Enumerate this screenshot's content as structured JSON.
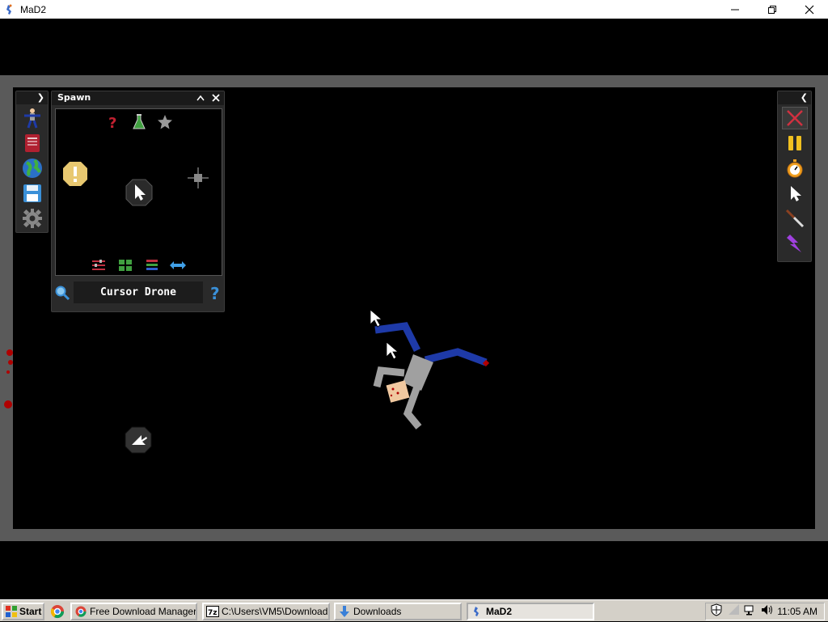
{
  "window": {
    "title": "MaD2",
    "minimize_icon": "minimize-icon",
    "maximize_icon": "restore-icon",
    "close_icon": "close-icon"
  },
  "left_panel": {
    "items": [
      {
        "name": "human-icon"
      },
      {
        "name": "book-icon"
      },
      {
        "name": "globe-icon"
      },
      {
        "name": "save-icon"
      },
      {
        "name": "gear-icon"
      }
    ]
  },
  "spawn_panel": {
    "title": "Spawn",
    "filter_icons": [
      "question-icon",
      "flask-icon",
      "star-icon"
    ],
    "items": [
      "warning-item-icon",
      "cursor-drone-icon",
      "crosshair-icon"
    ],
    "view_icons": [
      "sliders-icon",
      "grid-icon",
      "list-icon",
      "swap-icon"
    ],
    "selected_name": "Cursor Drone"
  },
  "right_toolbar": {
    "tools": [
      "close-tool-icon",
      "pause-icon",
      "stopwatch-icon",
      "pointer-icon",
      "knife-icon",
      "lightning-icon"
    ]
  },
  "taskbar": {
    "start_label": "Start",
    "buttons": [
      {
        "label": "Free Download Manager -...",
        "icon": "chrome-icon"
      },
      {
        "label": "C:\\Users\\VM5\\Download...",
        "icon": "7zip-icon"
      },
      {
        "label": "Downloads",
        "icon": "download-arrow-icon"
      },
      {
        "label": "MaD2",
        "icon": "mad2-icon"
      }
    ],
    "clock": "11:05 AM"
  },
  "colors": {
    "background": "#000000",
    "frame": "#5a5a5a",
    "panel": "#2a2a2a",
    "ragdoll_blue": "#1e3aa8",
    "ragdoll_grey": "#a0a0a0",
    "blood": "#c00000"
  }
}
